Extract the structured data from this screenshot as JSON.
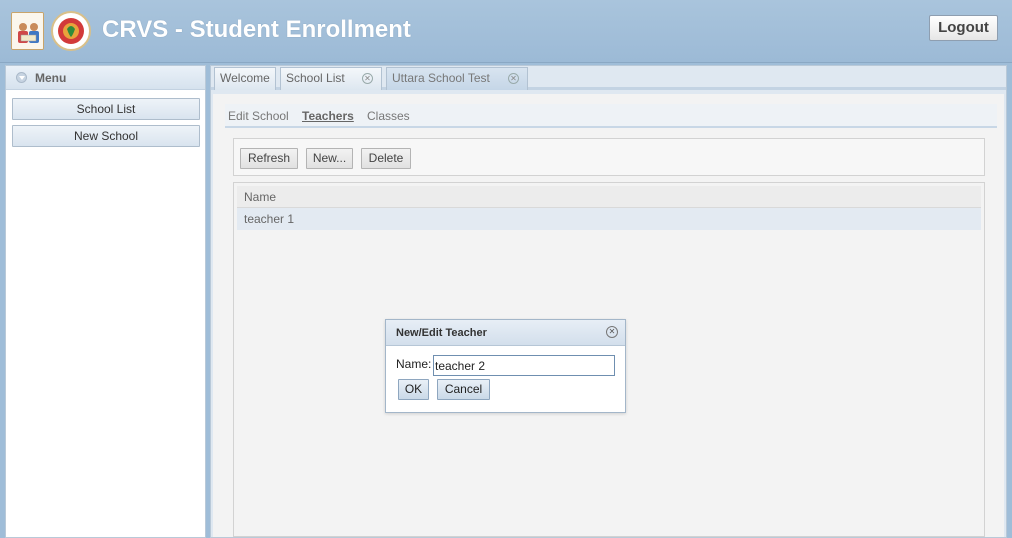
{
  "header": {
    "title": "CRVS - Student Enrollment",
    "logout_label": "Logout"
  },
  "menu": {
    "title": "Menu",
    "items": [
      {
        "label": "School List"
      },
      {
        "label": "New School"
      }
    ]
  },
  "tabs": [
    {
      "label": "Welcome",
      "closable": false,
      "active": false
    },
    {
      "label": "School List",
      "closable": true,
      "active": false
    },
    {
      "label": "Uttara School Test",
      "closable": true,
      "active": true
    }
  ],
  "subtabs": [
    {
      "label": "Edit School",
      "active": false
    },
    {
      "label": "Teachers",
      "active": true
    },
    {
      "label": "Classes",
      "active": false
    }
  ],
  "toolbar": {
    "refresh_label": "Refresh",
    "new_label": "New...",
    "delete_label": "Delete"
  },
  "grid": {
    "columns": [
      "Name"
    ],
    "rows": [
      [
        "teacher 1"
      ]
    ]
  },
  "dialog": {
    "title": "New/Edit Teacher",
    "name_label": "Name:",
    "name_value": "teacher 2",
    "ok_label": "OK",
    "cancel_label": "Cancel"
  }
}
